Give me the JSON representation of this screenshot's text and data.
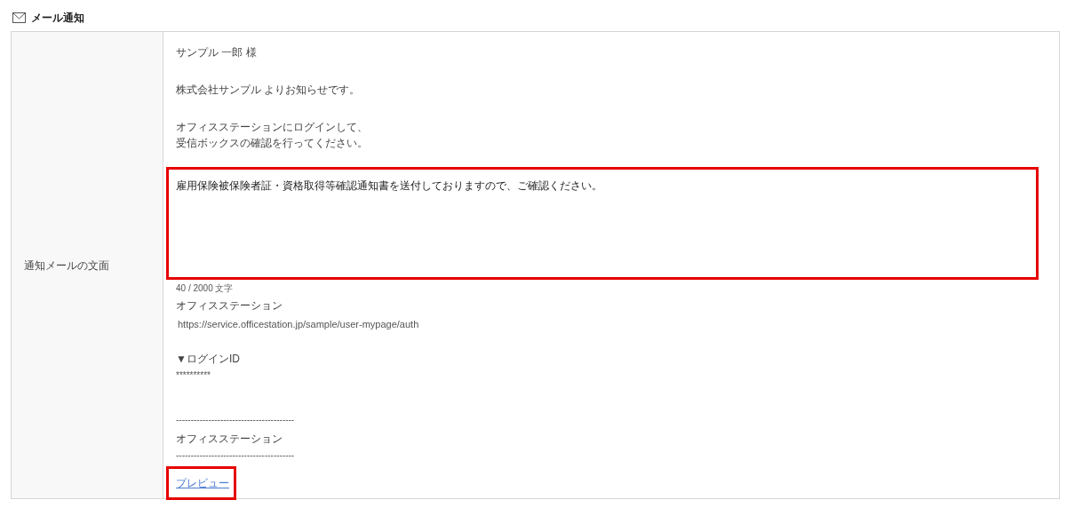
{
  "section": {
    "title": "メール通知"
  },
  "row": {
    "label": "通知メールの文面"
  },
  "intro": [
    [
      "サンプル 一郎 様"
    ],
    [
      "株式会社サンプル よりお知らせです。"
    ],
    [
      "オフィスステーションにログインして、",
      "受信ボックスの確認を行ってください。"
    ]
  ],
  "message": {
    "value": "雇用保険被保険者証・資格取得等確認通知書を送付しておりますので、ご確認ください。",
    "highlighted": true,
    "counter": "40 / 2000 文字"
  },
  "footer": [
    {
      "kind": "text",
      "text": "オフィスステーション"
    },
    {
      "kind": "url",
      "text": "https://service.officestation.jp/sample/user-mypage/auth"
    },
    {
      "kind": "gap"
    },
    {
      "kind": "text",
      "text": "▼ログインID"
    },
    {
      "kind": "small",
      "text": "**********"
    },
    {
      "kind": "gap"
    },
    {
      "kind": "gap"
    },
    {
      "kind": "small",
      "text": "----------------------------------------"
    },
    {
      "kind": "text",
      "text": "オフィスステーション"
    },
    {
      "kind": "small",
      "text": "----------------------------------------"
    }
  ],
  "preview_link": {
    "label": "プレビュー",
    "highlighted": true
  }
}
